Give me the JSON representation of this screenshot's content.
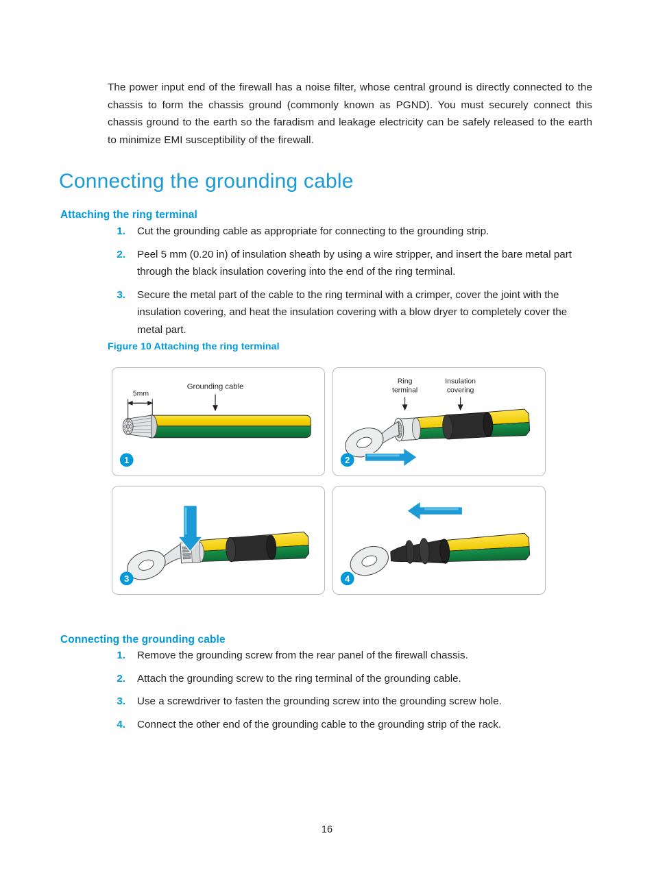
{
  "document": {
    "page_number": "16",
    "accent_color": "#0099da",
    "heading_color": "#1b9ad6",
    "body_color": "#231f20"
  },
  "intro": {
    "paragraph": "The power input end of the firewall has a noise filter, whose central ground is directly connected to the chassis to form the chassis ground (commonly known as PGND). You must securely connect this chassis ground to the earth so the faradism and leakage electricity can be safely released to the earth to minimize EMI susceptibility of the firewall."
  },
  "section_heading": "Connecting the grounding cable",
  "attaching": {
    "heading": "Attaching the ring terminal",
    "steps": [
      {
        "num": "1.",
        "text": "Cut the grounding cable as appropriate for connecting to the grounding strip."
      },
      {
        "num": "2.",
        "text": "Peel 5 mm (0.20 in) of insulation sheath by using a wire stripper, and insert the bare metal part through the black insulation covering into the end of the ring terminal."
      },
      {
        "num": "3.",
        "text": "Secure the metal part of the cable to the ring terminal with a crimper, cover the joint with the insulation covering, and heat the insulation covering with a blow dryer to completely cover the metal part."
      }
    ]
  },
  "figure": {
    "caption": "Figure 10 Attaching the ring terminal",
    "colors": {
      "cable_yellow": "#f5d200",
      "cable_green": "#0f7a3d",
      "insulation_black": "#2b2b2b",
      "metal_light": "#e8e9ea",
      "metal_outline": "#4d4d4d",
      "arrow_blue": "#1b9ad6",
      "arrow_blue_light": "#5fc3e8",
      "badge_blue": "#0099da",
      "panel_border": "#b9bcbe"
    },
    "panels": [
      {
        "badge": "1",
        "name": "stripped-cable",
        "labels": [
          {
            "text": "Grounding cable"
          },
          {
            "text": "5mm"
          }
        ]
      },
      {
        "badge": "2",
        "name": "insert-into-ring-terminal",
        "labels": [
          {
            "text": "Ring",
            "text2": "terminal"
          },
          {
            "text": "Insulation",
            "text2": "covering"
          }
        ]
      },
      {
        "badge": "3",
        "name": "crimp-ring-terminal",
        "labels": []
      },
      {
        "badge": "4",
        "name": "slide-insulation-covering",
        "labels": []
      }
    ]
  },
  "connecting": {
    "heading": "Connecting the grounding cable",
    "steps": [
      {
        "num": "1.",
        "text": "Remove the grounding screw from the rear panel of the firewall chassis."
      },
      {
        "num": "2.",
        "text": "Attach the grounding screw to the ring terminal of the grounding cable."
      },
      {
        "num": "3.",
        "text": "Use a screwdriver to fasten the grounding screw into the grounding screw hole."
      },
      {
        "num": "4.",
        "text": "Connect the other end of the grounding cable to the grounding strip of the rack."
      }
    ]
  }
}
